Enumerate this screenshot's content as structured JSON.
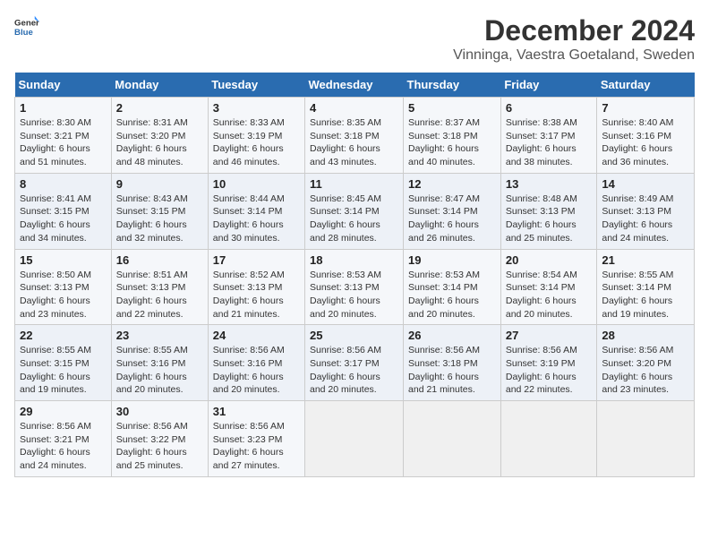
{
  "header": {
    "logo_general": "General",
    "logo_blue": "Blue",
    "title": "December 2024",
    "subtitle": "Vinninga, Vaestra Goetaland, Sweden"
  },
  "weekdays": [
    "Sunday",
    "Monday",
    "Tuesday",
    "Wednesday",
    "Thursday",
    "Friday",
    "Saturday"
  ],
  "weeks": [
    [
      {
        "day": "1",
        "rise": "Sunrise: 8:30 AM",
        "set": "Sunset: 3:21 PM",
        "daylight": "Daylight: 6 hours and 51 minutes."
      },
      {
        "day": "2",
        "rise": "Sunrise: 8:31 AM",
        "set": "Sunset: 3:20 PM",
        "daylight": "Daylight: 6 hours and 48 minutes."
      },
      {
        "day": "3",
        "rise": "Sunrise: 8:33 AM",
        "set": "Sunset: 3:19 PM",
        "daylight": "Daylight: 6 hours and 46 minutes."
      },
      {
        "day": "4",
        "rise": "Sunrise: 8:35 AM",
        "set": "Sunset: 3:18 PM",
        "daylight": "Daylight: 6 hours and 43 minutes."
      },
      {
        "day": "5",
        "rise": "Sunrise: 8:37 AM",
        "set": "Sunset: 3:18 PM",
        "daylight": "Daylight: 6 hours and 40 minutes."
      },
      {
        "day": "6",
        "rise": "Sunrise: 8:38 AM",
        "set": "Sunset: 3:17 PM",
        "daylight": "Daylight: 6 hours and 38 minutes."
      },
      {
        "day": "7",
        "rise": "Sunrise: 8:40 AM",
        "set": "Sunset: 3:16 PM",
        "daylight": "Daylight: 6 hours and 36 minutes."
      }
    ],
    [
      {
        "day": "8",
        "rise": "Sunrise: 8:41 AM",
        "set": "Sunset: 3:15 PM",
        "daylight": "Daylight: 6 hours and 34 minutes."
      },
      {
        "day": "9",
        "rise": "Sunrise: 8:43 AM",
        "set": "Sunset: 3:15 PM",
        "daylight": "Daylight: 6 hours and 32 minutes."
      },
      {
        "day": "10",
        "rise": "Sunrise: 8:44 AM",
        "set": "Sunset: 3:14 PM",
        "daylight": "Daylight: 6 hours and 30 minutes."
      },
      {
        "day": "11",
        "rise": "Sunrise: 8:45 AM",
        "set": "Sunset: 3:14 PM",
        "daylight": "Daylight: 6 hours and 28 minutes."
      },
      {
        "day": "12",
        "rise": "Sunrise: 8:47 AM",
        "set": "Sunset: 3:14 PM",
        "daylight": "Daylight: 6 hours and 26 minutes."
      },
      {
        "day": "13",
        "rise": "Sunrise: 8:48 AM",
        "set": "Sunset: 3:13 PM",
        "daylight": "Daylight: 6 hours and 25 minutes."
      },
      {
        "day": "14",
        "rise": "Sunrise: 8:49 AM",
        "set": "Sunset: 3:13 PM",
        "daylight": "Daylight: 6 hours and 24 minutes."
      }
    ],
    [
      {
        "day": "15",
        "rise": "Sunrise: 8:50 AM",
        "set": "Sunset: 3:13 PM",
        "daylight": "Daylight: 6 hours and 23 minutes."
      },
      {
        "day": "16",
        "rise": "Sunrise: 8:51 AM",
        "set": "Sunset: 3:13 PM",
        "daylight": "Daylight: 6 hours and 22 minutes."
      },
      {
        "day": "17",
        "rise": "Sunrise: 8:52 AM",
        "set": "Sunset: 3:13 PM",
        "daylight": "Daylight: 6 hours and 21 minutes."
      },
      {
        "day": "18",
        "rise": "Sunrise: 8:53 AM",
        "set": "Sunset: 3:13 PM",
        "daylight": "Daylight: 6 hours and 20 minutes."
      },
      {
        "day": "19",
        "rise": "Sunrise: 8:53 AM",
        "set": "Sunset: 3:14 PM",
        "daylight": "Daylight: 6 hours and 20 minutes."
      },
      {
        "day": "20",
        "rise": "Sunrise: 8:54 AM",
        "set": "Sunset: 3:14 PM",
        "daylight": "Daylight: 6 hours and 20 minutes."
      },
      {
        "day": "21",
        "rise": "Sunrise: 8:55 AM",
        "set": "Sunset: 3:14 PM",
        "daylight": "Daylight: 6 hours and 19 minutes."
      }
    ],
    [
      {
        "day": "22",
        "rise": "Sunrise: 8:55 AM",
        "set": "Sunset: 3:15 PM",
        "daylight": "Daylight: 6 hours and 19 minutes."
      },
      {
        "day": "23",
        "rise": "Sunrise: 8:55 AM",
        "set": "Sunset: 3:16 PM",
        "daylight": "Daylight: 6 hours and 20 minutes."
      },
      {
        "day": "24",
        "rise": "Sunrise: 8:56 AM",
        "set": "Sunset: 3:16 PM",
        "daylight": "Daylight: 6 hours and 20 minutes."
      },
      {
        "day": "25",
        "rise": "Sunrise: 8:56 AM",
        "set": "Sunset: 3:17 PM",
        "daylight": "Daylight: 6 hours and 20 minutes."
      },
      {
        "day": "26",
        "rise": "Sunrise: 8:56 AM",
        "set": "Sunset: 3:18 PM",
        "daylight": "Daylight: 6 hours and 21 minutes."
      },
      {
        "day": "27",
        "rise": "Sunrise: 8:56 AM",
        "set": "Sunset: 3:19 PM",
        "daylight": "Daylight: 6 hours and 22 minutes."
      },
      {
        "day": "28",
        "rise": "Sunrise: 8:56 AM",
        "set": "Sunset: 3:20 PM",
        "daylight": "Daylight: 6 hours and 23 minutes."
      }
    ],
    [
      {
        "day": "29",
        "rise": "Sunrise: 8:56 AM",
        "set": "Sunset: 3:21 PM",
        "daylight": "Daylight: 6 hours and 24 minutes."
      },
      {
        "day": "30",
        "rise": "Sunrise: 8:56 AM",
        "set": "Sunset: 3:22 PM",
        "daylight": "Daylight: 6 hours and 25 minutes."
      },
      {
        "day": "31",
        "rise": "Sunrise: 8:56 AM",
        "set": "Sunset: 3:23 PM",
        "daylight": "Daylight: 6 hours and 27 minutes."
      },
      null,
      null,
      null,
      null
    ]
  ]
}
